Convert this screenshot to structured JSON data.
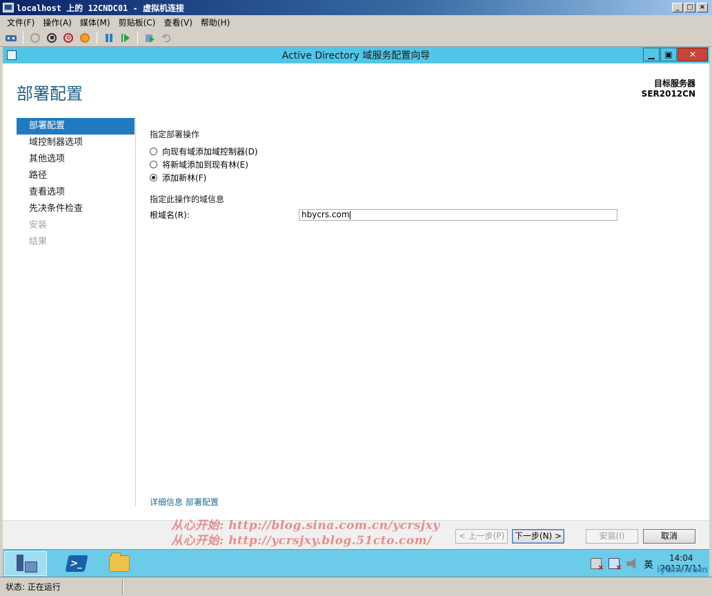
{
  "host": {
    "title": "localhost 上的 12CNDC01 - 虚拟机连接",
    "caption_min": "_",
    "caption_max": "□",
    "caption_close": "×",
    "menu": [
      "文件(F)",
      "操作(A)",
      "媒体(M)",
      "剪贴板(C)",
      "查看(V)",
      "帮助(H)"
    ],
    "status": "状态: 正在运行"
  },
  "wizard": {
    "title": "Active Directory 域服务配置向导",
    "page_heading": "部署配置",
    "target_server_label": "目标服务器",
    "target_server_name": "SER2012CN",
    "nav": [
      {
        "label": "部署配置",
        "state": "active"
      },
      {
        "label": "域控制器选项",
        "state": "normal"
      },
      {
        "label": "其他选项",
        "state": "normal"
      },
      {
        "label": "路径",
        "state": "normal"
      },
      {
        "label": "查看选项",
        "state": "normal"
      },
      {
        "label": "先决条件检查",
        "state": "normal"
      },
      {
        "label": "安装",
        "state": "disabled"
      },
      {
        "label": "结果",
        "state": "disabled"
      }
    ],
    "deployment_label": "指定部署操作",
    "options": [
      {
        "label": "向现有域添加域控制器(D)",
        "checked": false
      },
      {
        "label": "将新域添加到现有林(E)",
        "checked": false
      },
      {
        "label": "添加新林(F)",
        "checked": true
      }
    ],
    "domain_info_label": "指定此操作的域信息",
    "root_domain_label": "根域名(R):",
    "root_domain_value": "hbycrs.com",
    "more_info": "详细信息 部署配置",
    "buttons": {
      "prev": "< 上一步(P)",
      "next": "下一步(N) >",
      "install": "安装(I)",
      "cancel": "取消"
    }
  },
  "watermark": {
    "line1": "从心开始: http://blog.sina.com.cn/ycrsjxy",
    "line2": "从心开始: http://ycrsjxy.blog.51cto.com/"
  },
  "taskbar": {
    "language": "英",
    "time": "14:04",
    "date": "2012/7/11",
    "corner_logo": "iyunv.com"
  },
  "colors": {
    "accent": "#1f7abf",
    "title_bar": "#52c6e8",
    "taskbar": "#6ccbe8",
    "heading": "#1e5f87"
  }
}
